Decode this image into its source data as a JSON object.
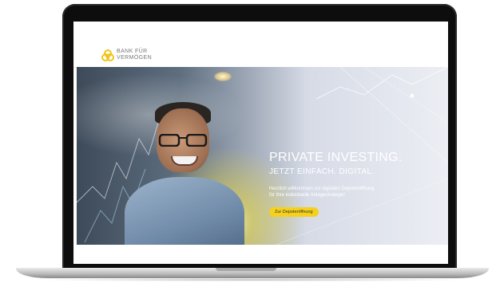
{
  "brand": {
    "line1": "BANK FÜR",
    "line2": "VERMÖGEN",
    "accent": "#f5d11d"
  },
  "hero": {
    "title": "PRIVATE INVESTING.",
    "subtitle": "JETZT EINFACH. DIGITAL.",
    "text_line1": "Herzlich willkommen zur digitalen Depoteröffnung",
    "text_line2": "für Ihre individuelle Anlagestrategie!",
    "cta_label": "Zur Depoteröffnung"
  },
  "icons": {
    "logo": "bank-logo-icon"
  }
}
